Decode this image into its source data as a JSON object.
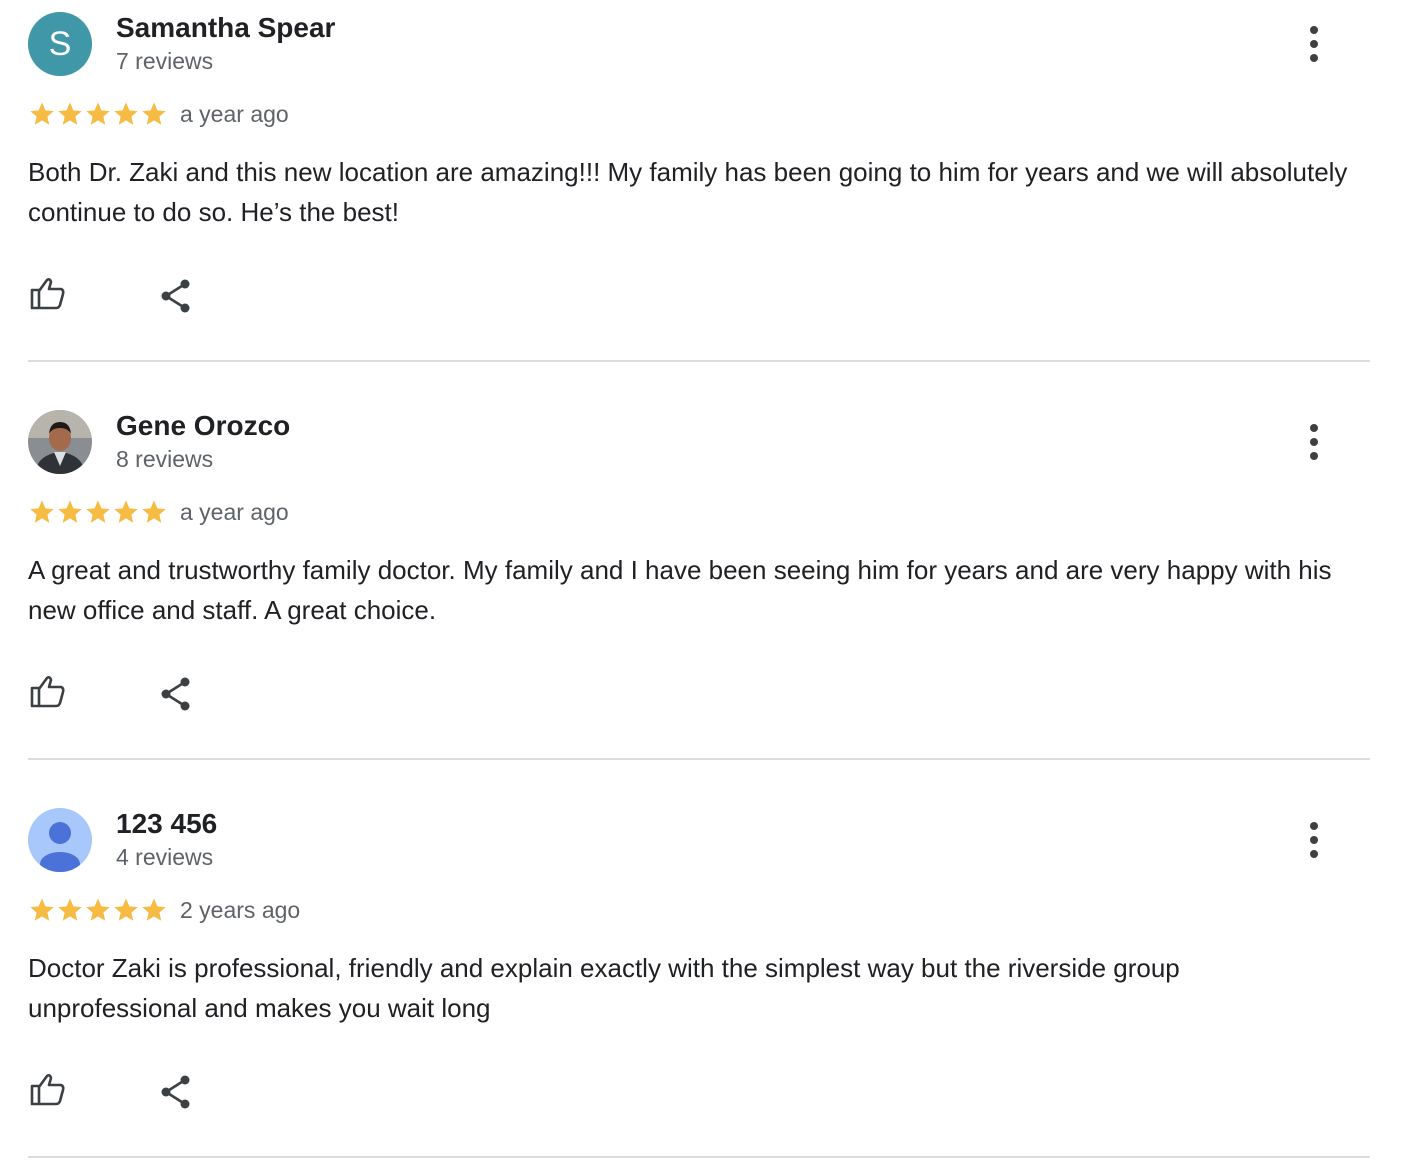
{
  "colors": {
    "star": "#f6bb42",
    "avatar_s_bg": "#3f97a7",
    "divider": "#dadce0",
    "secondary_text": "#5f6368"
  },
  "reviews": [
    {
      "name": "Samantha Spear",
      "count": "7 reviews",
      "avatar_letter": "S",
      "rating": 5,
      "date": "a year ago",
      "text": "Both Dr. Zaki and this new location are amazing!!! My family has been going to him for years and we will absolutely continue to do so. He’s the best!"
    },
    {
      "name": "Gene Orozco",
      "count": "8 reviews",
      "avatar": "profile-photo",
      "rating": 5,
      "date": "a year ago",
      "text": "A great and trustworthy family doctor. My family and I have been seeing him for years and are very happy with his new office and staff. A great choice."
    },
    {
      "name": "123 456",
      "count": "4 reviews",
      "avatar": "default-user-icon",
      "rating": 5,
      "date": "2 years ago",
      "text": "Doctor Zaki is professional, friendly and explain exactly with the simplest way but the riverside group unprofessional and makes you wait long"
    }
  ],
  "icons": {
    "like": "thumbs-up-icon",
    "share": "share-icon",
    "more": "more-vert-icon",
    "star": "star-icon"
  }
}
